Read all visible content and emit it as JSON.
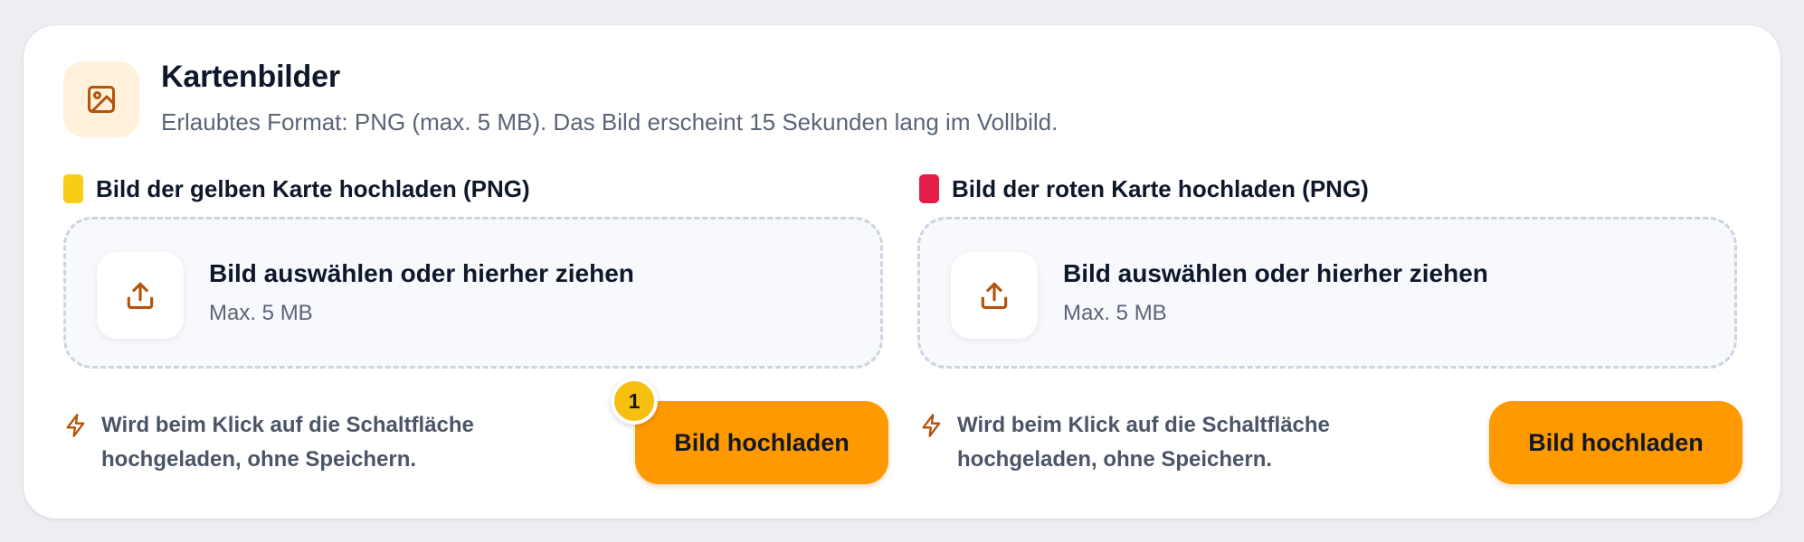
{
  "header": {
    "icon": "image-icon",
    "title": "Kartenbilder",
    "subtitle": "Erlaubtes Format: PNG (max. 5 MB). Das Bild erscheint 15 Sekunden lang im Vollbild."
  },
  "yellow_card": {
    "label": "Bild der gelben Karte hochladen (PNG)",
    "swatch_color": "#f9cc16",
    "dropzone": {
      "icon": "upload-icon",
      "title": "Bild auswählen oder hierher ziehen",
      "subtitle": "Max. 5 MB"
    },
    "note": "Wird beim Klick auf die Schaltfläche hochgeladen, ohne Speichern.",
    "button_label": "Bild hochladen",
    "badge": "1"
  },
  "red_card": {
    "label": "Bild der roten Karte hochladen (PNG)",
    "swatch_color": "#e11d48",
    "dropzone": {
      "icon": "upload-icon",
      "title": "Bild auswählen oder hierher ziehen",
      "subtitle": "Max. 5 MB"
    },
    "note": "Wird beim Klick auf die Schaltfläche hochgeladen, ohne Speichern.",
    "button_label": "Bild hochladen"
  },
  "colors": {
    "accent": "#ff9900",
    "icon_brown": "#b45309",
    "badge": "#f7bf10"
  }
}
